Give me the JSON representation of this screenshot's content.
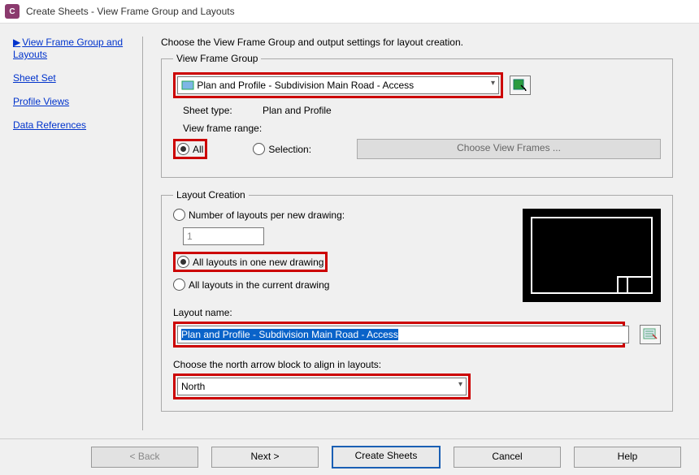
{
  "title": "Create Sheets - View Frame Group and Layouts",
  "sidebar": {
    "items": [
      {
        "label": "View Frame Group and Layouts",
        "active": true
      },
      {
        "label": "Sheet Set"
      },
      {
        "label": "Profile Views"
      },
      {
        "label": "Data References"
      }
    ]
  },
  "instruction": "Choose the View Frame Group and output settings for layout creation.",
  "vfg": {
    "legend": "View Frame Group",
    "dropdown": "Plan and Profile - Subdivision Main Road - Access",
    "sheet_type_label": "Sheet type:",
    "sheet_type_value": "Plan and Profile",
    "range_label": "View frame range:",
    "radio_all": "All",
    "radio_selection": "Selection:",
    "choose_frames_btn": "Choose View Frames ..."
  },
  "layout": {
    "legend": "Layout Creation",
    "radio_num_layouts": "Number of layouts per new drawing:",
    "num_value": "1",
    "radio_all_one": "All layouts in one new drawing",
    "radio_all_current": "All layouts in the current drawing",
    "layout_name_label": "Layout name:",
    "layout_name_value": "Plan and Profile - Subdivision Main Road - Access",
    "north_label": "Choose the north arrow block to align in layouts:",
    "north_value": "North"
  },
  "footer": {
    "back": "< Back",
    "next": "Next >",
    "create": "Create Sheets",
    "cancel": "Cancel",
    "help": "Help"
  }
}
